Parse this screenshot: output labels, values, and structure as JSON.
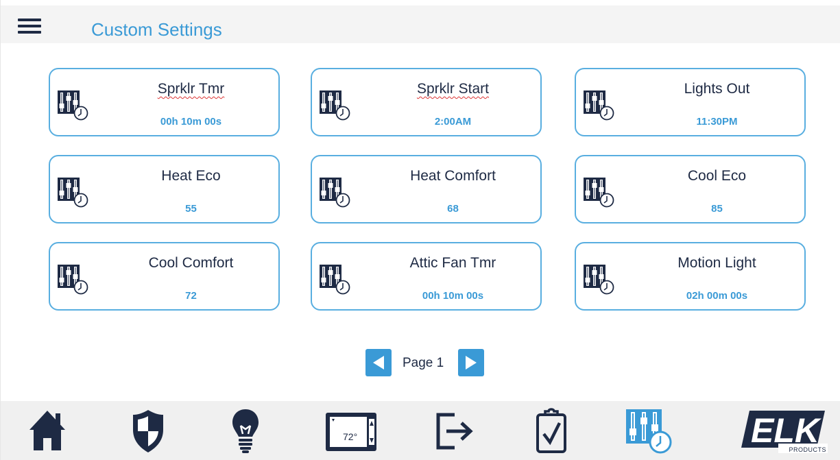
{
  "header": {
    "title": "Custom Settings",
    "menu_icon": "hamburger-menu-icon"
  },
  "tiles": [
    {
      "name": "Sprklr Tmr",
      "value": "00h 10m 00s",
      "icon": "sliders-clock-icon",
      "spell_flag": true
    },
    {
      "name": "Sprklr Start",
      "value": "2:00AM",
      "icon": "sliders-clock-icon",
      "spell_flag": true
    },
    {
      "name": "Lights Out",
      "value": "11:30PM",
      "icon": "sliders-clock-icon",
      "spell_flag": false
    },
    {
      "name": "Heat Eco",
      "value": "55",
      "icon": "sliders-clock-icon",
      "spell_flag": false
    },
    {
      "name": "Heat Comfort",
      "value": "68",
      "icon": "sliders-clock-icon",
      "spell_flag": false
    },
    {
      "name": "Cool Eco",
      "value": "85",
      "icon": "sliders-clock-icon",
      "spell_flag": false
    },
    {
      "name": "Cool Comfort",
      "value": "72",
      "icon": "sliders-clock-icon",
      "spell_flag": false
    },
    {
      "name": "Attic Fan Tmr",
      "value": "00h 10m 00s",
      "icon": "sliders-clock-icon",
      "spell_flag": false
    },
    {
      "name": "Motion Light",
      "value": "02h 00m 00s",
      "icon": "sliders-clock-icon",
      "spell_flag": false
    }
  ],
  "pager": {
    "label": "Page 1",
    "prev_icon": "arrow-left-icon",
    "next_icon": "arrow-right-icon"
  },
  "nav": {
    "items": [
      {
        "name": "home",
        "icon": "home-icon"
      },
      {
        "name": "security",
        "icon": "shield-icon"
      },
      {
        "name": "lighting",
        "icon": "lightbulb-icon"
      },
      {
        "name": "thermostat",
        "icon": "thermostat-icon",
        "reading": "72°"
      },
      {
        "name": "exit",
        "icon": "exit-arrow-icon"
      },
      {
        "name": "tasks",
        "icon": "clipboard-check-icon"
      },
      {
        "name": "custom-settings",
        "icon": "sliders-clock-icon",
        "active": true
      }
    ],
    "logo": {
      "icon": "elk-logo",
      "wordmark": "ELK",
      "tagline": "PRODUCTS"
    }
  },
  "colors": {
    "accent": "#3a9ad6",
    "tile_border": "#58aee0",
    "dark_navy": "#1e2a44",
    "header_bg": "#f4f4f4",
    "bar_bg": "#f0f0f0"
  }
}
